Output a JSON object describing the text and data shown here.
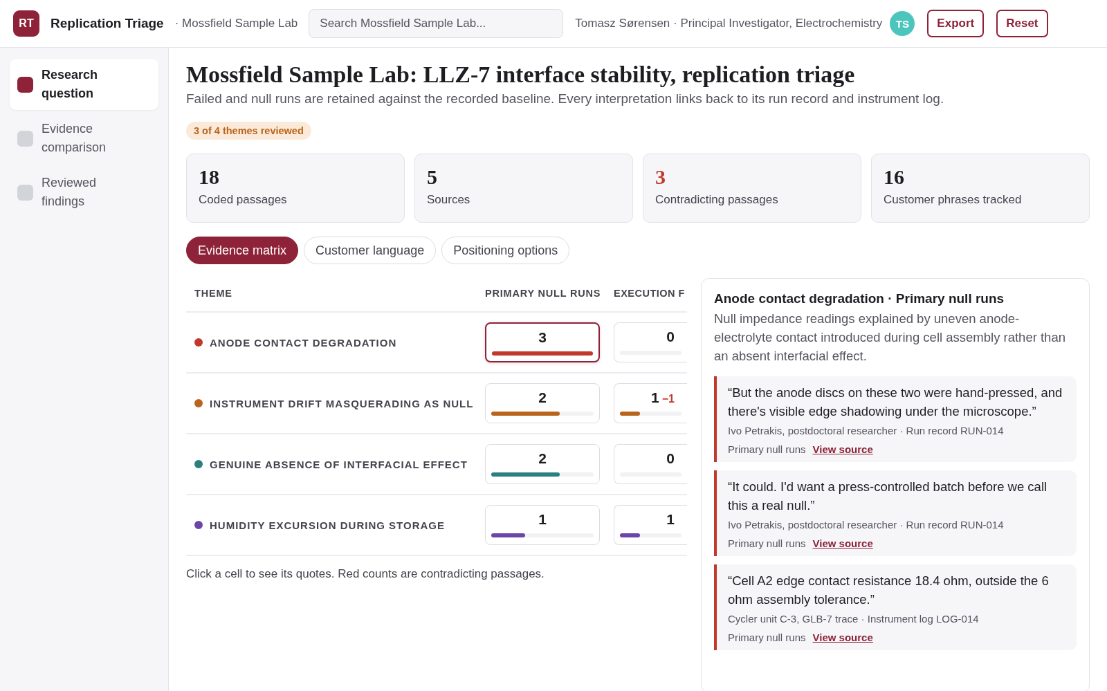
{
  "app": {
    "logo": "RT",
    "title": "Replication Triage",
    "workspace": "· Mossfield Sample Lab",
    "search_placeholder": "Search Mossfield Sample Lab...",
    "user": "Tomasz Sørensen · Principal Investigator, Electrochemistry",
    "avatar": "TS",
    "buttons": [
      "Export",
      "Reset"
    ]
  },
  "sidebar": {
    "items": [
      {
        "label": "Research question",
        "selected": true
      },
      {
        "label": "Evidence comparison",
        "selected": false
      },
      {
        "label": "Reviewed findings",
        "selected": false
      }
    ]
  },
  "page": {
    "title": "Mossfield Sample Lab: LLZ-7 interface stability, replication triage",
    "subtitle": "Failed and null runs are retained against the recorded baseline. Every interpretation links back to its run record and instrument log.",
    "badge": "3 of 4 themes reviewed"
  },
  "stats": [
    {
      "value": "18",
      "label": "Coded passages",
      "alert": false
    },
    {
      "value": "5",
      "label": "Sources",
      "alert": false
    },
    {
      "value": "3",
      "label": "Contradicting passages",
      "alert": true
    },
    {
      "value": "16",
      "label": "Customer phrases tracked",
      "alert": false
    }
  ],
  "tabs": [
    {
      "label": "Evidence matrix",
      "selected": true
    },
    {
      "label": "Customer language",
      "selected": false
    },
    {
      "label": "Positioning options",
      "selected": false
    }
  ],
  "table": {
    "columns": [
      "THEME",
      "PRIMARY NULL RUNS",
      "EXECUTION F"
    ],
    "rows": [
      {
        "cells": [
          {
            "theme": "ANODE CONTACT DEGRADATION",
            "color": "#c0392b"
          },
          {
            "count": "3",
            "level": 1,
            "selected": true
          },
          {
            "count": "0",
            "selected": false
          }
        ]
      },
      {
        "cells": [
          {
            "theme": "INSTRUMENT DRIFT MASQUERADING AS NULL",
            "color": "#b8641c"
          },
          {
            "count": "2",
            "level": 0.67,
            "selected": false
          },
          {
            "count": "1",
            "delta": "−1",
            "level": 0.33,
            "selected": false
          }
        ]
      },
      {
        "cells": [
          {
            "theme": "GENUINE ABSENCE OF INTERFACIAL EFFECT",
            "color": "#2a7f80"
          },
          {
            "count": "2",
            "level": 0.67,
            "selected": false
          },
          {
            "count": "0",
            "selected": false
          }
        ]
      },
      {
        "cells": [
          {
            "theme": "HUMIDITY EXCURSION DURING STORAGE",
            "color": "#6b46a8"
          },
          {
            "count": "1",
            "level": 0.33,
            "selected": false
          },
          {
            "count": "1",
            "level": 0.33,
            "selected": false
          }
        ]
      }
    ],
    "footnote": "Click a cell to see its quotes. Red counts are contradicting passages."
  },
  "detail": {
    "title": "Anode contact degradation · Primary null runs",
    "summary": "Null impedance readings explained by uneven anode-electrolyte contact introduced during cell assembly rather than an absent interfacial effect.",
    "quotes": [
      {
        "text": "“But the anode discs on these two were hand-pressed, and there's visible edge shadowing under the microscope.”",
        "source": "Ivo Petrakis, postdoctoral researcher · Run record RUN-014",
        "tag": "Primary null runs",
        "link": "View source"
      },
      {
        "text": "“It could. I'd want a press-controlled batch before we call this a real null.”",
        "source": "Ivo Petrakis, postdoctoral researcher · Run record RUN-014",
        "tag": "Primary null runs",
        "link": "View source"
      },
      {
        "text": "“Cell A2 edge contact resistance 18.4 ohm, outside the 6 ohm assembly tolerance.”",
        "source": "Cycler unit C-3, GLB-7 trace · Instrument log LOG-014",
        "tag": "Primary null runs",
        "link": "View source"
      }
    ]
  }
}
